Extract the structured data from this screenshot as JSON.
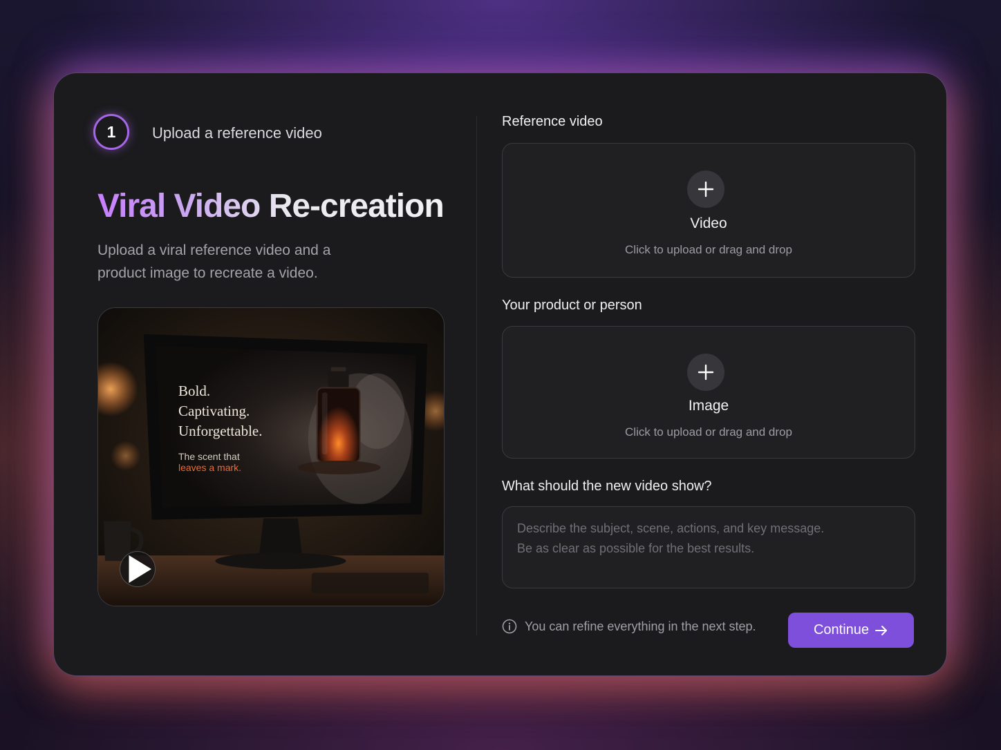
{
  "step": {
    "number": "1",
    "label": "Upload a reference video"
  },
  "hero": {
    "title": "Viral Video Re-creation",
    "subtitle": "Upload a viral reference video and a product image to recreate a video."
  },
  "preview": {
    "headline_lines": [
      "Bold.",
      "Captivating.",
      "Unforgettable."
    ],
    "tagline_1": "The scent that",
    "tagline_2": "leaves a mark."
  },
  "reference_video": {
    "label": "Reference video",
    "title": "Video",
    "hint": "Click to upload or drag and drop"
  },
  "product": {
    "label": "Your product or person",
    "title": "Image",
    "hint": "Click to upload or drag and drop"
  },
  "prompt": {
    "label": "What should the new video show?",
    "placeholder": "Describe the subject, scene, actions, and key message.\nBe as clear as possible for the best results.",
    "value": ""
  },
  "footer": {
    "info_text": "You can refine everything in the next step.",
    "continue_label": "Continue"
  },
  "colors": {
    "accent": "#7d4fdb",
    "badge_ring": "#a666e8",
    "title_gradient_start": "#c77dff",
    "highlight_text": "#f06a30"
  },
  "icons": {
    "play": "play-icon",
    "plus": "plus-icon",
    "info": "info-icon",
    "arrow": "arrow-right-icon"
  }
}
